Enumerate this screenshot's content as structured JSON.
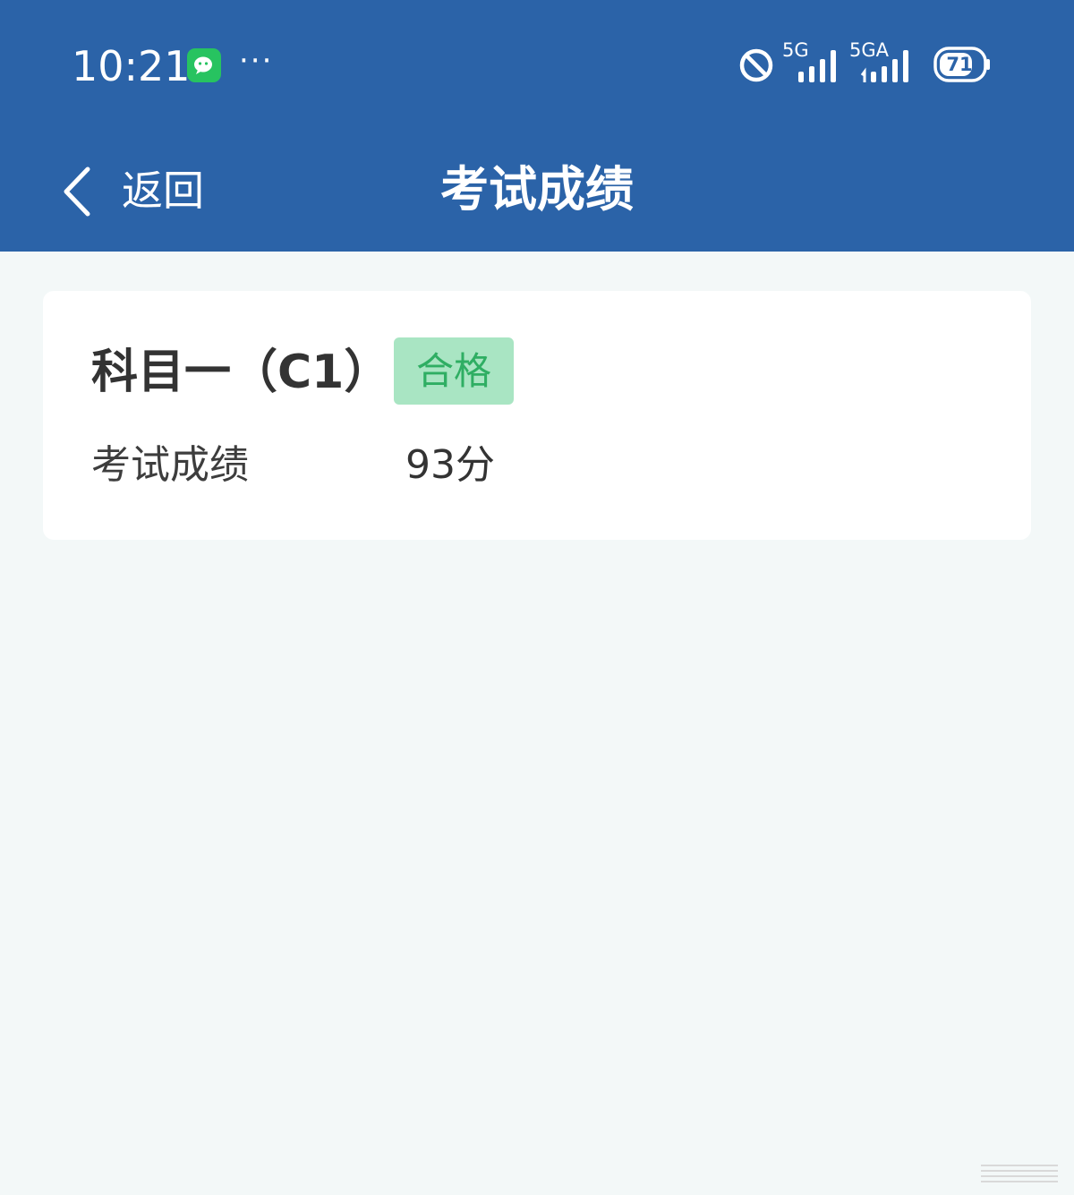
{
  "status_bar": {
    "time": "10:21",
    "notification_icons": [
      "wechat-icon",
      "more-dots"
    ],
    "more_indicator": "···",
    "signal_1_label": "5G",
    "signal_2_label": "5GA",
    "battery_level": "71"
  },
  "nav": {
    "back_label": "返回",
    "title": "考试成绩"
  },
  "result_card": {
    "subject": "科目一（C1）",
    "status_badge": "合格",
    "score_label": "考试成绩",
    "score_value": "93分"
  },
  "colors": {
    "header_bg": "#2b63a8",
    "page_bg": "#f3f8f8",
    "badge_bg": "#a9e5c3",
    "badge_text": "#2fae63",
    "wechat_green": "#27c360"
  }
}
